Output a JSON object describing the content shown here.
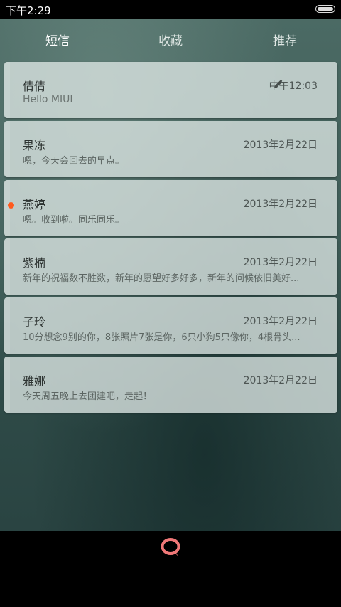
{
  "status_bar": {
    "time": "下午2:29"
  },
  "tabs": [
    {
      "label": "短信",
      "active": true
    },
    {
      "label": "收藏",
      "active": false
    },
    {
      "label": "推荐",
      "active": false
    }
  ],
  "messages": [
    {
      "name": "倩倩",
      "date": "中午12:03",
      "preview": "Hello MIUI",
      "draft": true,
      "unread": false
    },
    {
      "name": "果冻",
      "date": "2013年2月22日",
      "preview": "嗯，今天会回去的早点。",
      "draft": false,
      "unread": false
    },
    {
      "name": "燕婷",
      "date": "2013年2月22日",
      "preview": "嗯。收到啦。同乐同乐。",
      "draft": false,
      "unread": true
    },
    {
      "name": "紫楠",
      "date": "2013年2月22日",
      "preview": "新年的祝福数不胜数，新年的愿望好多好多，新年的问候依旧美好...",
      "draft": false,
      "unread": false
    },
    {
      "name": "子玲",
      "date": "2013年2月22日",
      "preview": "10分想念9别的你，8张照片7张是你，6只小狗5只像你，4根骨头...",
      "draft": false,
      "unread": false
    },
    {
      "name": "雅娜",
      "date": "2013年2月22日",
      "preview": "今天周五晚上去团建吧，走起！",
      "draft": false,
      "unread": false
    }
  ],
  "colors": {
    "unread_dot": "#ff5a1e",
    "compose_icon": "#f07878"
  },
  "icons": {
    "draft": "pencil-icon",
    "compose": "compose-message-icon"
  }
}
